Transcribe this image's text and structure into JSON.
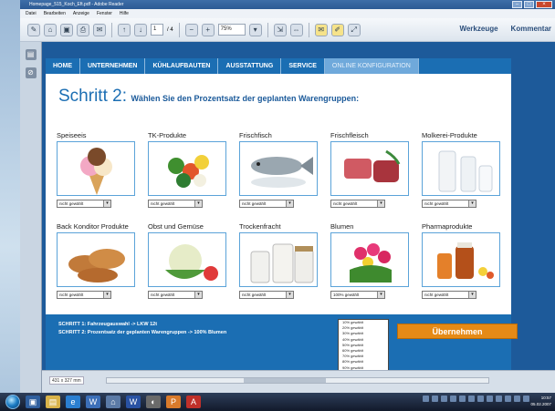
{
  "window": {
    "title": "Homepage_515_Koch_Eft.pdf - Adobe Reader",
    "menu": [
      "Datei",
      "Bearbeiten",
      "Anzeige",
      "Fenster",
      "Hilfe"
    ]
  },
  "toolbar": {
    "page_current": "1",
    "page_total": "/ 4",
    "zoom": "75%",
    "tools_label": "Werkzeuge",
    "comment_label": "Kommentar"
  },
  "nav": {
    "items": [
      "HOME",
      "UNTERNEHMEN",
      "KÜHLAUFBAUTEN",
      "AUSSTATTUNG",
      "SERVICE",
      "ONLINE KONFIGURATION"
    ],
    "active_index": 5
  },
  "heading": {
    "title": "Schritt 2:",
    "subtitle": "Wählen Sie den Prozentsatz der geplanten Warengruppen:"
  },
  "groups": [
    {
      "label": "Speiseeis",
      "select": "nicht gewählt",
      "icon": "ice-cream-icon"
    },
    {
      "label": "TK-Produkte",
      "select": "nicht gewählt",
      "icon": "frozen-vegetables-icon"
    },
    {
      "label": "Frischfisch",
      "select": "nicht gewählt",
      "icon": "fish-icon"
    },
    {
      "label": "Frischfleisch",
      "select": "nicht gewählt",
      "icon": "meat-icon"
    },
    {
      "label": "Molkerei-Produkte",
      "select": "nicht gewählt",
      "icon": "milk-icon"
    },
    {
      "label": "Back Konditor Produkte",
      "select": "nicht gewählt",
      "icon": "bread-icon"
    },
    {
      "label": "Obst und Gemüse",
      "select": "nicht gewählt",
      "icon": "cauliflower-icon"
    },
    {
      "label": "Trockenfracht",
      "select": "nicht gewählt",
      "icon": "jars-icon"
    },
    {
      "label": "Blumen",
      "select": "100% gewählt",
      "icon": "flowers-icon"
    },
    {
      "label": "Pharmaprodukte",
      "select": "nicht gewählt",
      "icon": "medicine-icon"
    }
  ],
  "dropdown_options": [
    "10% gewählt",
    "20% gewählt",
    "30% gewählt",
    "40% gewählt",
    "50% gewählt",
    "60% gewählt",
    "70% gewählt",
    "80% gewählt",
    "90% gewählt",
    "100% gewählt"
  ],
  "dropdown_selected_index": 9,
  "summary": {
    "line1": "SCHRITT 1:  Fahrzeugauswahl -> LKW 12t",
    "line2": "SCHRITT 2:  Prozentsatz der geplanten Warengruppen -> 100% Blumen"
  },
  "apply_button": "Übernehmen",
  "status": {
    "page_size": "431 x 327 mm"
  },
  "clock": {
    "time": "10:57",
    "date": "05.02.2007"
  }
}
